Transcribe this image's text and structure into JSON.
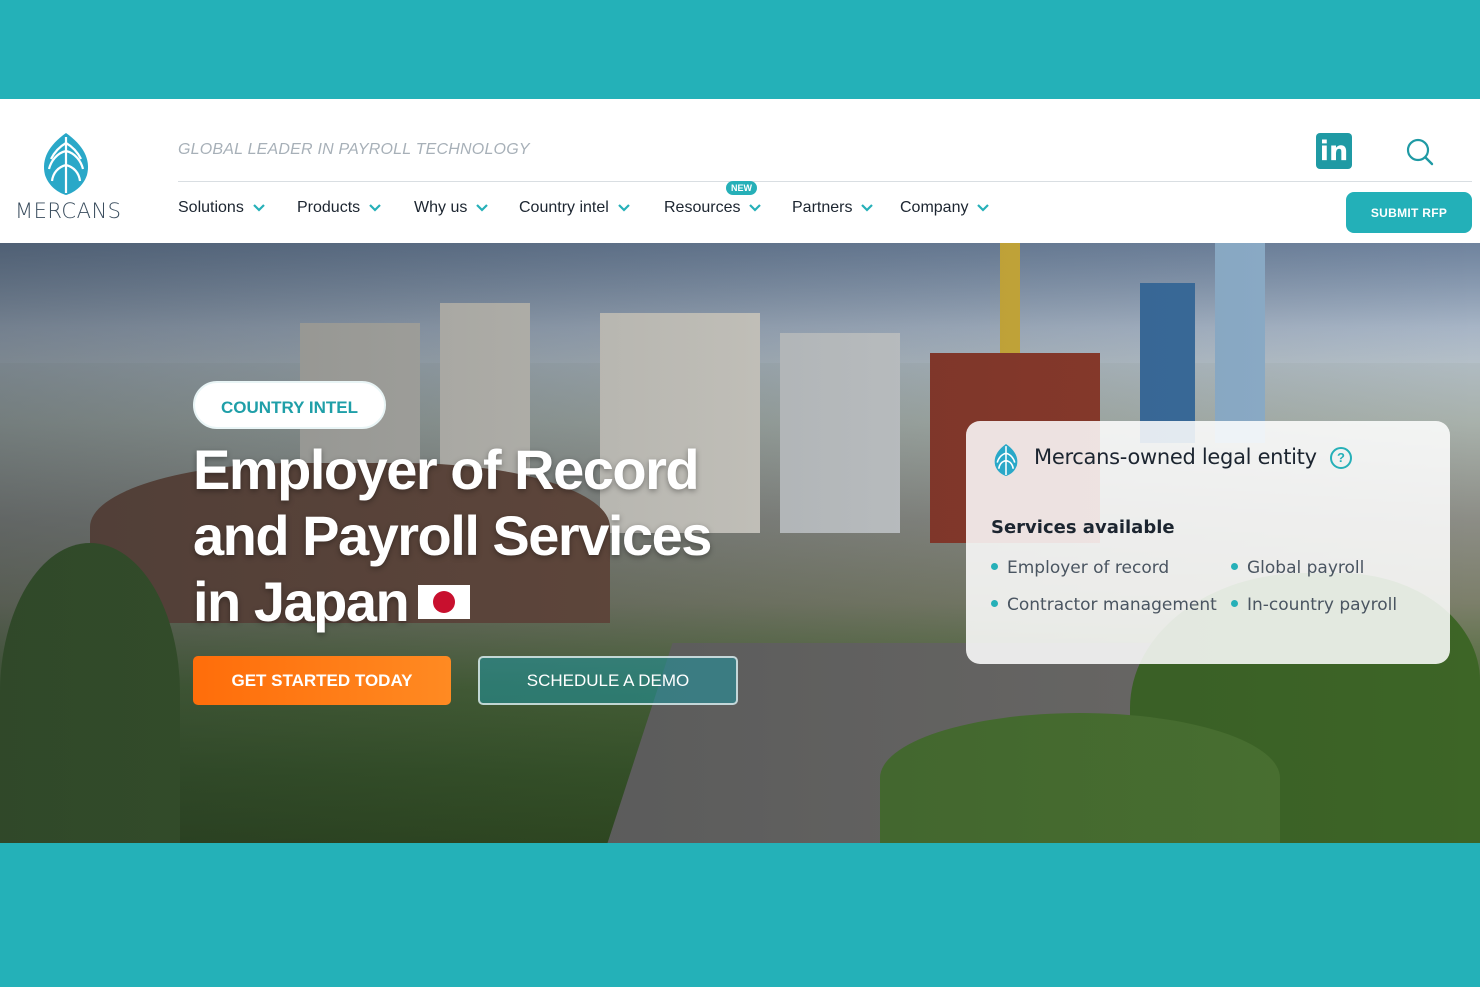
{
  "brand": {
    "name": "MERCANS",
    "tagline": "GLOBAL LEADER IN PAYROLL TECHNOLOGY",
    "accent": "#24b1b8",
    "cta_color": "#ff7a12"
  },
  "header": {
    "social_label": "in",
    "nav": [
      {
        "label": "Solutions"
      },
      {
        "label": "Products"
      },
      {
        "label": "Why us"
      },
      {
        "label": "Country intel"
      },
      {
        "label": "Resources",
        "badge": "NEW"
      },
      {
        "label": "Partners"
      },
      {
        "label": "Company"
      }
    ],
    "submit_rfp": "SUBMIT RFP"
  },
  "hero": {
    "pill": "COUNTRY INTEL",
    "headline_line1": "Employer of Record",
    "headline_line2": "and Payroll Services",
    "headline_line3": "in Japan",
    "cta_primary": "GET STARTED TODAY",
    "cta_secondary": "SCHEDULE A DEMO"
  },
  "card": {
    "title": "Mercans-owned legal entity",
    "help": "?",
    "subtitle": "Services available",
    "services": [
      "Employer of record",
      "Global payroll",
      "Contractor management",
      "In-country payroll"
    ]
  }
}
